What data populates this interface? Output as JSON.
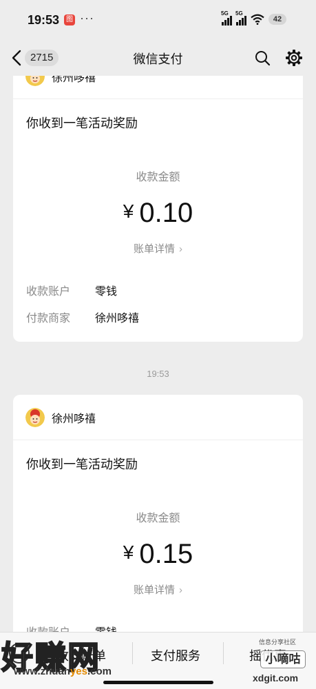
{
  "status_bar": {
    "time": "19:53",
    "signal1_label": "5G",
    "signal2_label": "5G",
    "battery": "42",
    "app_badge": "图",
    "more": "···"
  },
  "nav": {
    "back_count": "2715",
    "title": "微信支付",
    "icons": [
      "back-arrow-icon",
      "search-icon",
      "gear-icon"
    ]
  },
  "messages": [
    {
      "merchant": "徐州哆禧",
      "title": "你收到一笔活动奖励",
      "amount_label": "收款金额",
      "currency": "¥",
      "amount": "0.10",
      "detail_link": "账单详情",
      "account_key": "收款账户",
      "account_value": "零钱",
      "payer_key": "付款商家",
      "payer_value": "徐州哆禧"
    },
    {
      "merchant": "徐州哆禧",
      "title": "你收到一笔活动奖励",
      "amount_label": "收款金额",
      "currency": "¥",
      "amount": "0.15",
      "detail_link": "账单详情",
      "account_key": "收款账户",
      "account_value": "零钱"
    }
  ],
  "timestamp": "19:53",
  "bottom_menu": {
    "items": [
      "收支账单",
      "支付服务",
      "摇优惠"
    ]
  },
  "watermark": {
    "left_text": "好赚网",
    "left_url_1": "www.zhuan",
    "left_url_hl": "yes",
    "left_url_2": ".com",
    "right_top": "信息分享社区",
    "right_mid": "小嘀咕",
    "right_url": "xdgit.com"
  },
  "colors": {
    "background": "#ededed",
    "card": "#ffffff",
    "muted_text": "#8a8a8a",
    "watermark_accent": "#e38a00"
  }
}
